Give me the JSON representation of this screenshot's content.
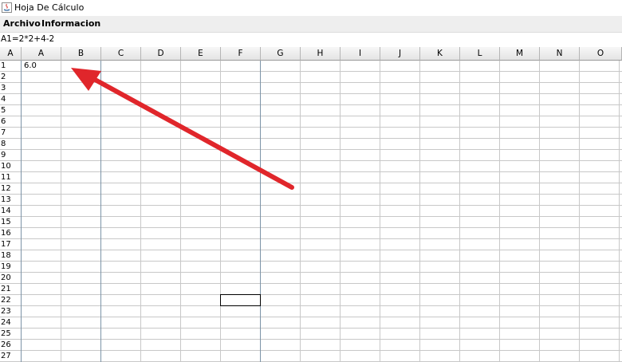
{
  "window": {
    "title": "Hoja De Cálculo"
  },
  "menu": [
    {
      "label": "Archivo"
    },
    {
      "label": "Informacion"
    }
  ],
  "formula": "A1=2*2+4-2",
  "sheet": {
    "corner_label": "A",
    "columns": [
      "A",
      "B",
      "C",
      "D",
      "E",
      "F",
      "G",
      "H",
      "I",
      "J",
      "K",
      "L",
      "M",
      "N",
      "O"
    ],
    "rows": [
      "1",
      "2",
      "3",
      "4",
      "5",
      "6",
      "7",
      "8",
      "9",
      "10",
      "11",
      "12",
      "13",
      "14",
      "15",
      "16",
      "17",
      "18",
      "19",
      "20",
      "21",
      "22",
      "23",
      "24",
      "25",
      "26",
      "27"
    ],
    "cells": {
      "A1": "6.0"
    },
    "selected_cell": "F22"
  },
  "annotation": {
    "type": "arrow",
    "color": "#e0262b",
    "points_to": "A1"
  }
}
